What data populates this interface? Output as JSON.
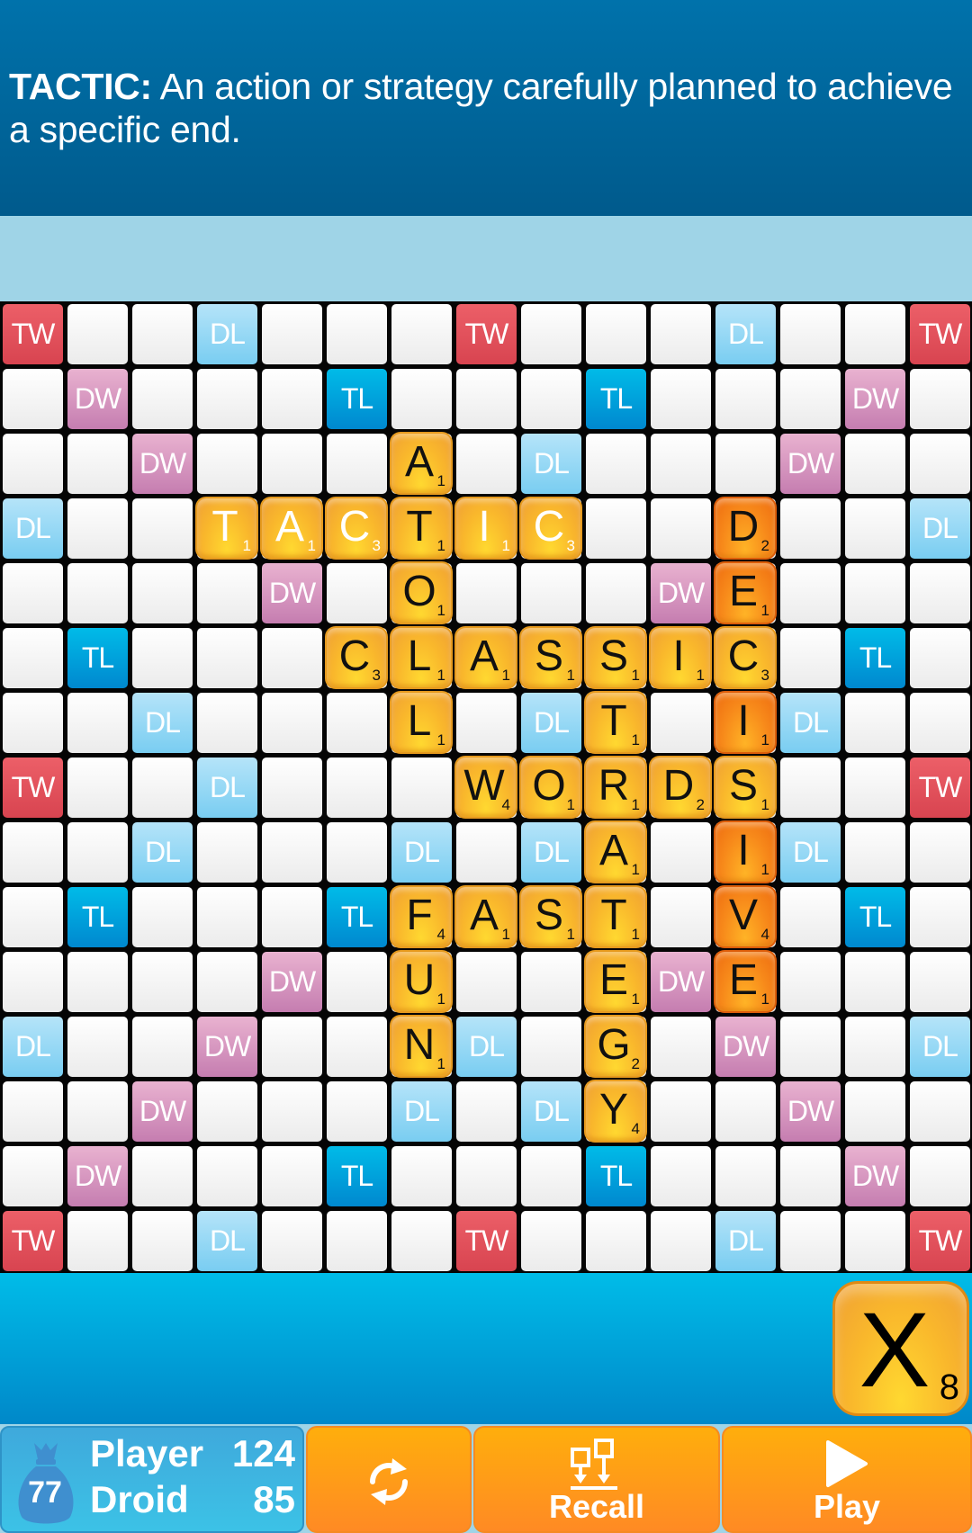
{
  "header": {
    "term": "TACTIC:",
    "definition": "An action or strategy carefully planned to achieve a specific end."
  },
  "board": {
    "size": 15,
    "premium_labels": {
      "TW": "TW",
      "DW": "DW",
      "TL": "TL",
      "DL": "DL"
    },
    "premium_squares": [
      "TW..DL...TW...DL..TW",
      ".DW...TL...TL...DW.",
      "..DW...A.DL...DW.."
    ],
    "premium_grid": [
      [
        "TW",
        "",
        "",
        "DL",
        "",
        "",
        "",
        "TW",
        "",
        "",
        "",
        "DL",
        "",
        "",
        "TW"
      ],
      [
        "",
        "DW",
        "",
        "",
        "",
        "TL",
        "",
        "",
        "",
        "TL",
        "",
        "",
        "",
        "DW",
        ""
      ],
      [
        "",
        "",
        "DW",
        "",
        "",
        "",
        "",
        "",
        "DL",
        "",
        "",
        "",
        "DW",
        "",
        ""
      ],
      [
        "DL",
        "",
        "",
        "",
        "",
        "",
        "",
        "",
        "",
        "",
        "",
        "",
        "",
        "",
        "DL"
      ],
      [
        "",
        "",
        "",
        "",
        "DW",
        "",
        "",
        "",
        "",
        "",
        "DW",
        "",
        "",
        "",
        ""
      ],
      [
        "",
        "TL",
        "",
        "",
        "",
        "",
        "",
        "",
        "",
        "",
        "",
        "",
        "",
        "TL",
        ""
      ],
      [
        "",
        "",
        "DL",
        "",
        "",
        "",
        "",
        "",
        "DL",
        "",
        "",
        "",
        "DL",
        "",
        ""
      ],
      [
        "TW",
        "",
        "",
        "DL",
        "",
        "",
        "",
        "",
        "",
        "",
        "",
        "",
        "",
        "",
        "TW"
      ],
      [
        "",
        "",
        "DL",
        "",
        "",
        "",
        "DL",
        "",
        "DL",
        "",
        "",
        "",
        "DL",
        "",
        ""
      ],
      [
        "",
        "TL",
        "",
        "",
        "",
        "TL",
        "",
        "",
        "",
        "",
        "",
        "",
        "",
        "TL",
        ""
      ],
      [
        "",
        "",
        "",
        "",
        "DW",
        "",
        "",
        "",
        "",
        "",
        "DW",
        "",
        "",
        "",
        ""
      ],
      [
        "DL",
        "",
        "",
        "DW",
        "",
        "",
        "",
        "DL",
        "",
        "",
        "",
        "DW",
        "",
        "",
        "DL"
      ],
      [
        "",
        "",
        "DW",
        "",
        "",
        "",
        "DL",
        "",
        "DL",
        "",
        "",
        "",
        "DW",
        "",
        ""
      ],
      [
        "",
        "DW",
        "",
        "",
        "",
        "TL",
        "",
        "",
        "",
        "TL",
        "",
        "",
        "",
        "DW",
        ""
      ],
      [
        "TW",
        "",
        "",
        "DL",
        "",
        "",
        "",
        "TW",
        "",
        "",
        "",
        "DL",
        "",
        "",
        "TW"
      ]
    ],
    "tiles": [
      {
        "row": 2,
        "col": 6,
        "letter": "A",
        "points": 1,
        "style": "normal"
      },
      {
        "row": 3,
        "col": 3,
        "letter": "T",
        "points": 1,
        "style": "white"
      },
      {
        "row": 3,
        "col": 4,
        "letter": "A",
        "points": 1,
        "style": "white"
      },
      {
        "row": 3,
        "col": 5,
        "letter": "C",
        "points": 3,
        "style": "white"
      },
      {
        "row": 3,
        "col": 6,
        "letter": "T",
        "points": 1,
        "style": "normal"
      },
      {
        "row": 3,
        "col": 7,
        "letter": "I",
        "points": 1,
        "style": "white"
      },
      {
        "row": 3,
        "col": 8,
        "letter": "C",
        "points": 3,
        "style": "white"
      },
      {
        "row": 3,
        "col": 11,
        "letter": "D",
        "points": 2,
        "style": "recent"
      },
      {
        "row": 4,
        "col": 6,
        "letter": "O",
        "points": 1,
        "style": "normal"
      },
      {
        "row": 4,
        "col": 11,
        "letter": "E",
        "points": 1,
        "style": "recent"
      },
      {
        "row": 5,
        "col": 5,
        "letter": "C",
        "points": 3,
        "style": "normal"
      },
      {
        "row": 5,
        "col": 6,
        "letter": "L",
        "points": 1,
        "style": "normal"
      },
      {
        "row": 5,
        "col": 7,
        "letter": "A",
        "points": 1,
        "style": "normal"
      },
      {
        "row": 5,
        "col": 8,
        "letter": "S",
        "points": 1,
        "style": "normal"
      },
      {
        "row": 5,
        "col": 9,
        "letter": "S",
        "points": 1,
        "style": "normal"
      },
      {
        "row": 5,
        "col": 10,
        "letter": "I",
        "points": 1,
        "style": "normal"
      },
      {
        "row": 5,
        "col": 11,
        "letter": "C",
        "points": 3,
        "style": "normal"
      },
      {
        "row": 6,
        "col": 6,
        "letter": "L",
        "points": 1,
        "style": "normal"
      },
      {
        "row": 6,
        "col": 9,
        "letter": "T",
        "points": 1,
        "style": "normal"
      },
      {
        "row": 6,
        "col": 11,
        "letter": "I",
        "points": 1,
        "style": "recent"
      },
      {
        "row": 7,
        "col": 7,
        "letter": "W",
        "points": 4,
        "style": "normal"
      },
      {
        "row": 7,
        "col": 8,
        "letter": "O",
        "points": 1,
        "style": "normal"
      },
      {
        "row": 7,
        "col": 9,
        "letter": "R",
        "points": 1,
        "style": "normal"
      },
      {
        "row": 7,
        "col": 10,
        "letter": "D",
        "points": 2,
        "style": "normal"
      },
      {
        "row": 7,
        "col": 11,
        "letter": "S",
        "points": 1,
        "style": "normal"
      },
      {
        "row": 8,
        "col": 9,
        "letter": "A",
        "points": 1,
        "style": "normal"
      },
      {
        "row": 8,
        "col": 11,
        "letter": "I",
        "points": 1,
        "style": "recent"
      },
      {
        "row": 9,
        "col": 6,
        "letter": "F",
        "points": 4,
        "style": "normal"
      },
      {
        "row": 9,
        "col": 7,
        "letter": "A",
        "points": 1,
        "style": "normal"
      },
      {
        "row": 9,
        "col": 8,
        "letter": "S",
        "points": 1,
        "style": "normal"
      },
      {
        "row": 9,
        "col": 9,
        "letter": "T",
        "points": 1,
        "style": "normal"
      },
      {
        "row": 9,
        "col": 11,
        "letter": "V",
        "points": 4,
        "style": "recent"
      },
      {
        "row": 10,
        "col": 6,
        "letter": "U",
        "points": 1,
        "style": "normal"
      },
      {
        "row": 10,
        "col": 9,
        "letter": "E",
        "points": 1,
        "style": "normal"
      },
      {
        "row": 10,
        "col": 11,
        "letter": "E",
        "points": 1,
        "style": "recent"
      },
      {
        "row": 11,
        "col": 6,
        "letter": "N",
        "points": 1,
        "style": "normal"
      },
      {
        "row": 11,
        "col": 9,
        "letter": "G",
        "points": 2,
        "style": "normal"
      },
      {
        "row": 12,
        "col": 9,
        "letter": "Y",
        "points": 4,
        "style": "normal"
      }
    ]
  },
  "rack": {
    "tiles": [
      {
        "letter": "X",
        "points": 8
      }
    ]
  },
  "scoreboard": {
    "tiles_in_bag": "77",
    "players": [
      {
        "name": "Player",
        "score": "124"
      },
      {
        "name": "Droid",
        "score": "85"
      }
    ]
  },
  "actions": {
    "shuffle_icon": "shuffle-icon",
    "recall_label": "Recall",
    "play_label": "Play"
  },
  "colors": {
    "header_bg": "#0067a0",
    "subheader_bg": "#9fd4e7",
    "TW": "#e0505a",
    "DW": "#d595c0",
    "TL": "#00a4de",
    "DL": "#93d7f4",
    "tile": "#f9b72c",
    "tile_recent": "#f27a14",
    "button": "#ff9a18"
  }
}
